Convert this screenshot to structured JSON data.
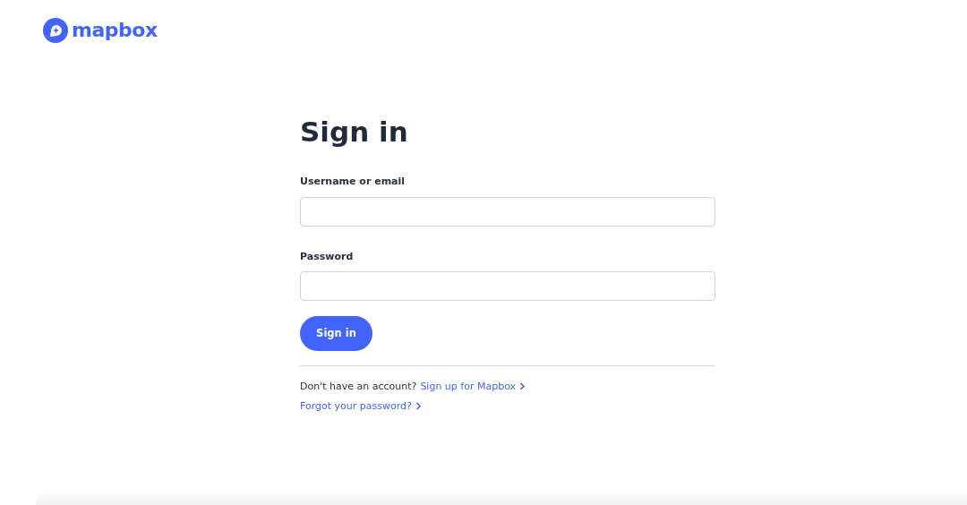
{
  "logo": {
    "text": "mapbox"
  },
  "title": "Sign in",
  "fields": [
    {
      "label": "Username or email"
    },
    {
      "label": "Password"
    }
  ],
  "submit_button": "Sign in",
  "signup": {
    "prompt": "Don't have an account?",
    "link": "Sign up for Mapbox"
  },
  "forgot_link": "Forgot your password?"
}
